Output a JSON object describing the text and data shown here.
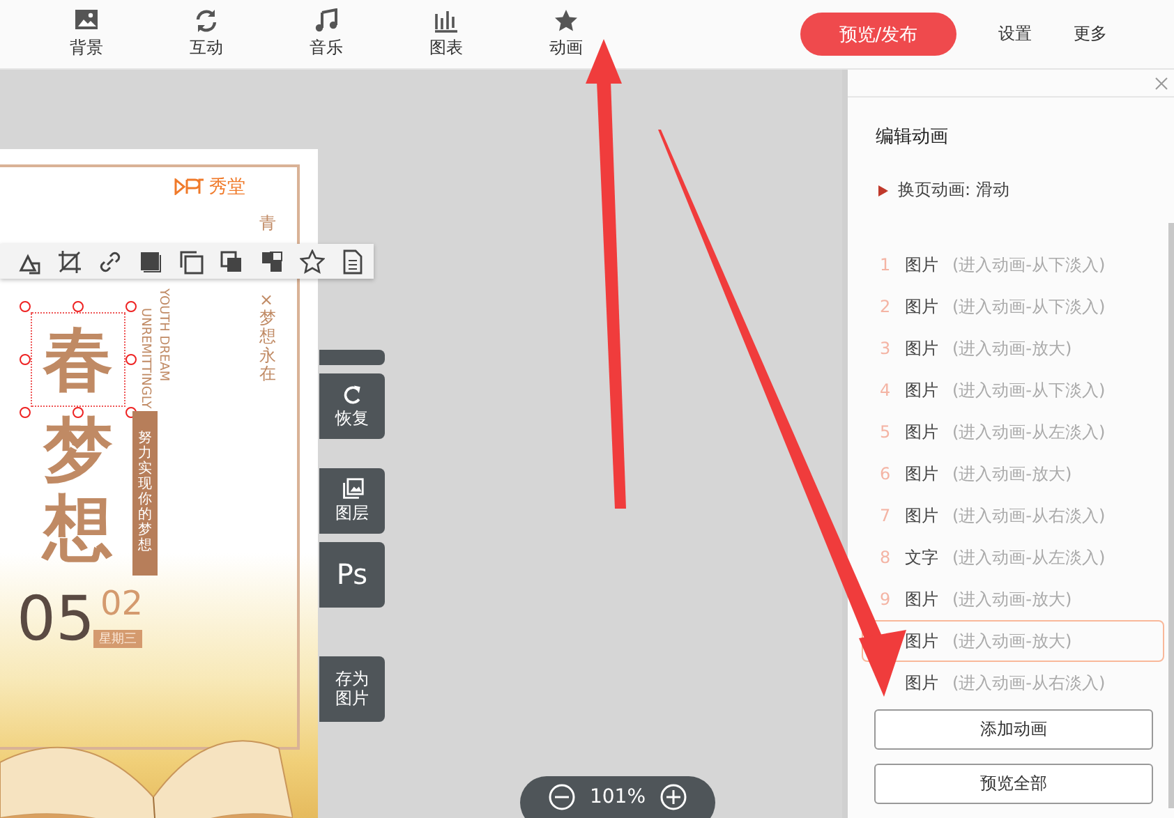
{
  "toolbar": {
    "items": [
      {
        "label": "背景",
        "kind": "image"
      },
      {
        "label": "互动",
        "kind": "refresh"
      },
      {
        "label": "音乐",
        "kind": "music"
      },
      {
        "label": "图表",
        "kind": "chart"
      },
      {
        "label": "动画",
        "kind": "star"
      }
    ],
    "publish_button": "预览/发布",
    "menu": [
      "设置",
      "更多"
    ]
  },
  "poster": {
    "brand": "秀堂",
    "title": [
      "春",
      "梦",
      "想"
    ],
    "english": [
      "YOUTH DREAM",
      "UNREMITTINGLY"
    ],
    "vertical_top": "青",
    "vertical_bottom": "×梦想永在",
    "tag": "努力实现你的梦想",
    "day": "05",
    "month": "02",
    "weekday": "星期三"
  },
  "side_tools": [
    {
      "kind": "undo"
    },
    {
      "label": "恢复",
      "kind": "redo"
    },
    {
      "label": "图层",
      "kind": "layers"
    },
    {
      "label": "Ps",
      "kind": "ps"
    },
    {
      "label": "存为图片",
      "kind": "save"
    }
  ],
  "zoom": {
    "value": "101%"
  },
  "panel": {
    "title": "编辑动画",
    "page_transition": "换页动画: 滑动",
    "animations": [
      {
        "number": "1",
        "target": "图片",
        "effect": "(进入动画-从下淡入)",
        "selected": false
      },
      {
        "number": "2",
        "target": "图片",
        "effect": "(进入动画-从下淡入)",
        "selected": false
      },
      {
        "number": "3",
        "target": "图片",
        "effect": "(进入动画-放大)",
        "selected": false
      },
      {
        "number": "4",
        "target": "图片",
        "effect": "(进入动画-从下淡入)",
        "selected": false
      },
      {
        "number": "5",
        "target": "图片",
        "effect": "(进入动画-从左淡入)",
        "selected": false
      },
      {
        "number": "6",
        "target": "图片",
        "effect": "(进入动画-放大)",
        "selected": false
      },
      {
        "number": "7",
        "target": "图片",
        "effect": "(进入动画-从右淡入)",
        "selected": false
      },
      {
        "number": "8",
        "target": "文字",
        "effect": "(进入动画-从左淡入)",
        "selected": false
      },
      {
        "number": "9",
        "target": "图片",
        "effect": "(进入动画-放大)",
        "selected": false
      },
      {
        "target": "图片",
        "effect": "(进入动画-放大)",
        "selected": true
      },
      {
        "target": "图片",
        "effect": "(进入动画-从右淡入)",
        "selected": false
      }
    ],
    "buttons": [
      "添加动画",
      "预览全部"
    ]
  }
}
